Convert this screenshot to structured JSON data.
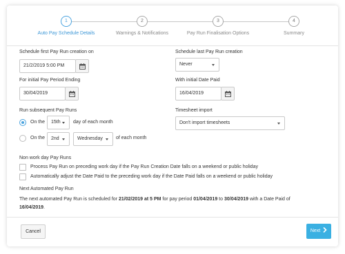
{
  "stepper": {
    "steps": [
      {
        "number": "1",
        "label": "Auto Pay Schedule Details",
        "active": true
      },
      {
        "number": "2",
        "label": "Warnings & Notifications",
        "active": false
      },
      {
        "number": "3",
        "label": "Pay Run Finalisation Options",
        "active": false
      },
      {
        "number": "4",
        "label": "Summary",
        "active": false
      }
    ]
  },
  "form": {
    "first_creation": {
      "label": "Schedule first Pay Run creation on",
      "value": "21/2/2019 5:00 PM"
    },
    "last_creation": {
      "label": "Schedule last Pay Run creation",
      "value": "Never"
    },
    "period_ending": {
      "label": "For initial Pay Period Ending",
      "value": "30/04/2019"
    },
    "date_paid": {
      "label": "With initial Date Paid",
      "value": "16/04/2019"
    },
    "subsequent": {
      "label": "Run subsequent Pay Runs",
      "option1": {
        "prefix": "On the",
        "day": "15th",
        "suffix": "day of each month",
        "selected": true
      },
      "option2": {
        "prefix": "On the",
        "ordinal": "2nd",
        "weekday": "Wednesday",
        "suffix": "of each month",
        "selected": false
      }
    },
    "timesheet": {
      "label": "Timesheet import",
      "value": "Don't import timesheets"
    },
    "non_work_day": {
      "label": "Non work day Pay Runs",
      "option1": "Process Pay Run on preceding work day if the Pay Run Creation Date falls on a weekend or public holiday",
      "option2": "Automatically adjust the Date Paid to the preceding work day if the Date Paid falls on a weekend or public holiday"
    }
  },
  "next_run": {
    "heading": "Next Automated Pay Run",
    "text_1": "The next automated Pay Run is scheduled for ",
    "creation": "21/02/2019 at 5 PM",
    "text_2": " for pay period ",
    "period_start": "01/04/2019",
    "text_3": " to ",
    "period_end": "30/04/2019",
    "text_4": " with a Date Paid of",
    "date_paid": "16/04/2019",
    "text_5": "."
  },
  "footer": {
    "cancel_label": "Cancel",
    "next_label": "Next",
    "next_icon": "chevron-right-icon"
  },
  "colors": {
    "accent": "#3ab0e2",
    "active_step": "#4aa3df"
  }
}
